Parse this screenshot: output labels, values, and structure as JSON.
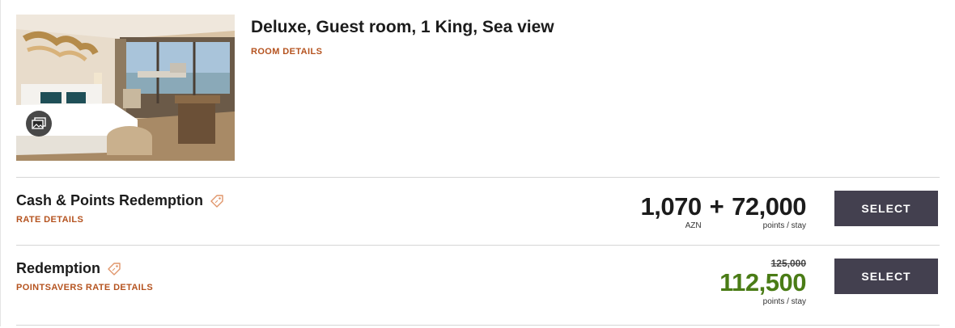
{
  "room": {
    "title": "Deluxe, Guest room, 1 King, Sea view",
    "details_link": "ROOM DETAILS",
    "photo_alt": "hotel-room-photo",
    "gallery_icon": "gallery-icon"
  },
  "rates": [
    {
      "name": "Cash & Points Redemption",
      "details_link": "RATE DETAILS",
      "cash_amount": "1,070",
      "plus": "+",
      "cash_currency": "AZN",
      "points_amount": "72,000",
      "points_unit": "points / stay",
      "button": "SELECT",
      "tag_icon": "tag-icon"
    },
    {
      "name": "Redemption",
      "details_link": "POINTSAVERS RATE DETAILS",
      "original_points": "125,000",
      "points_amount": "112,500",
      "points_unit": "points / stay",
      "button": "SELECT",
      "tag_icon": "tag-icon"
    }
  ],
  "colors": {
    "link": "#b5531f",
    "button_bg": "#43404f",
    "discount_green": "#4a7c16",
    "divider": "#d6d6d6"
  }
}
